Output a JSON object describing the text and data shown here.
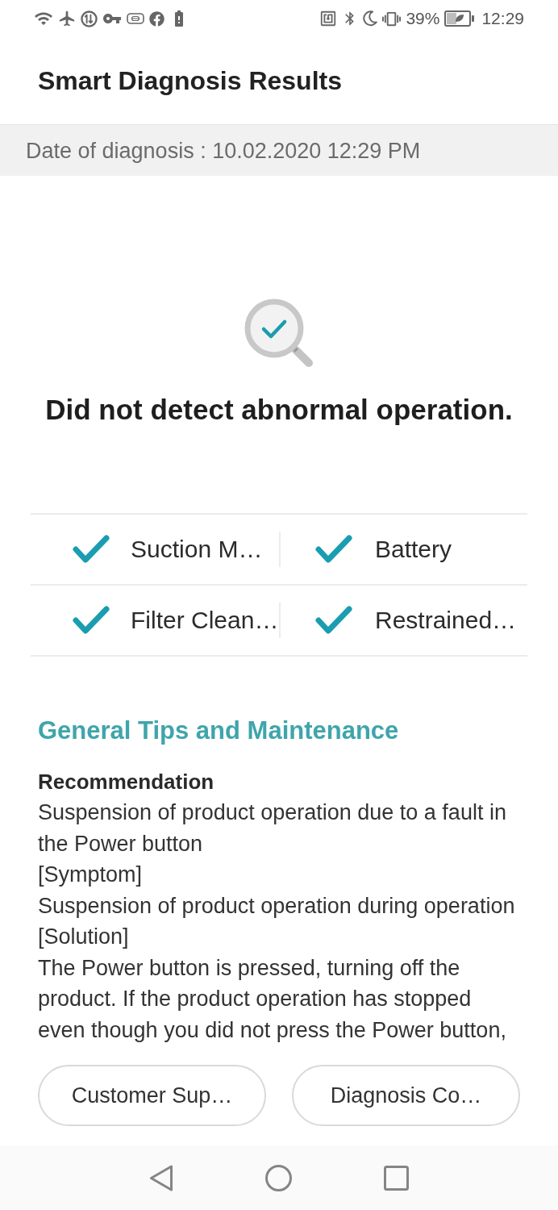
{
  "status_bar": {
    "battery": "39%",
    "time": "12:29"
  },
  "header": {
    "title": "Smart Diagnosis Results"
  },
  "date_bar": {
    "text": "Date of diagnosis : 10.02.2020 12:29 PM"
  },
  "result": {
    "message": "Did not detect abnormal operation."
  },
  "checks": [
    {
      "label": "Suction M…",
      "checked": true
    },
    {
      "label": "Battery",
      "checked": true
    },
    {
      "label": "Filter Clean…",
      "checked": true
    },
    {
      "label": "Restrained…",
      "checked": true
    }
  ],
  "tips": {
    "title": "General Tips and Maintenance",
    "heading": "Recommendation",
    "paragraphs": [
      "Suspension of product operation due to a fault in the Power button",
      "[Symptom]",
      "Suspension of product operation during operation",
      "[Solution]",
      "The Power button is pressed, turning off the product. If the product operation has stopped even though you did not press the Power button,"
    ]
  },
  "buttons": [
    {
      "label": "Customer Sup…"
    },
    {
      "label": "Diagnosis Co…"
    }
  ]
}
